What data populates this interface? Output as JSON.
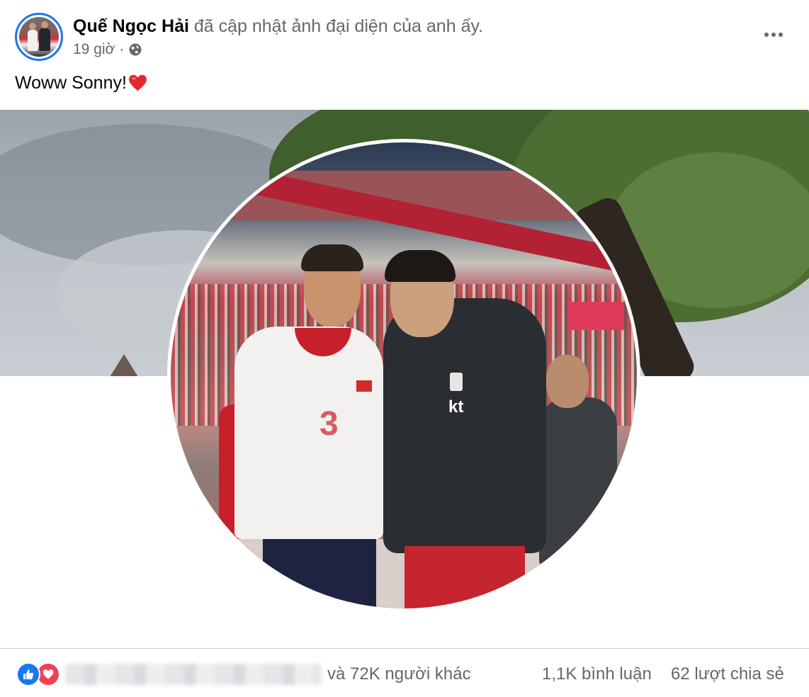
{
  "post": {
    "author": "Quế Ngọc Hải",
    "action": " đã cập nhật ảnh đại diện của anh ấy.",
    "time": "19 giờ",
    "separator": "·",
    "privacy_icon": "globe-icon",
    "more_icon": "more-options-icon",
    "caption": "Woww Sonny!",
    "caption_emoji": "red-heart-emoji"
  },
  "stats": {
    "reaction_icons": [
      "like-icon",
      "love-icon"
    ],
    "others": "và 72K người khác",
    "comments": "1,1K bình luận",
    "shares": "62 lượt chia sẻ"
  },
  "colors": {
    "accent": "#1877f2",
    "love": "#f33e58",
    "secondary_text": "#65676b",
    "primary_text": "#050505"
  }
}
